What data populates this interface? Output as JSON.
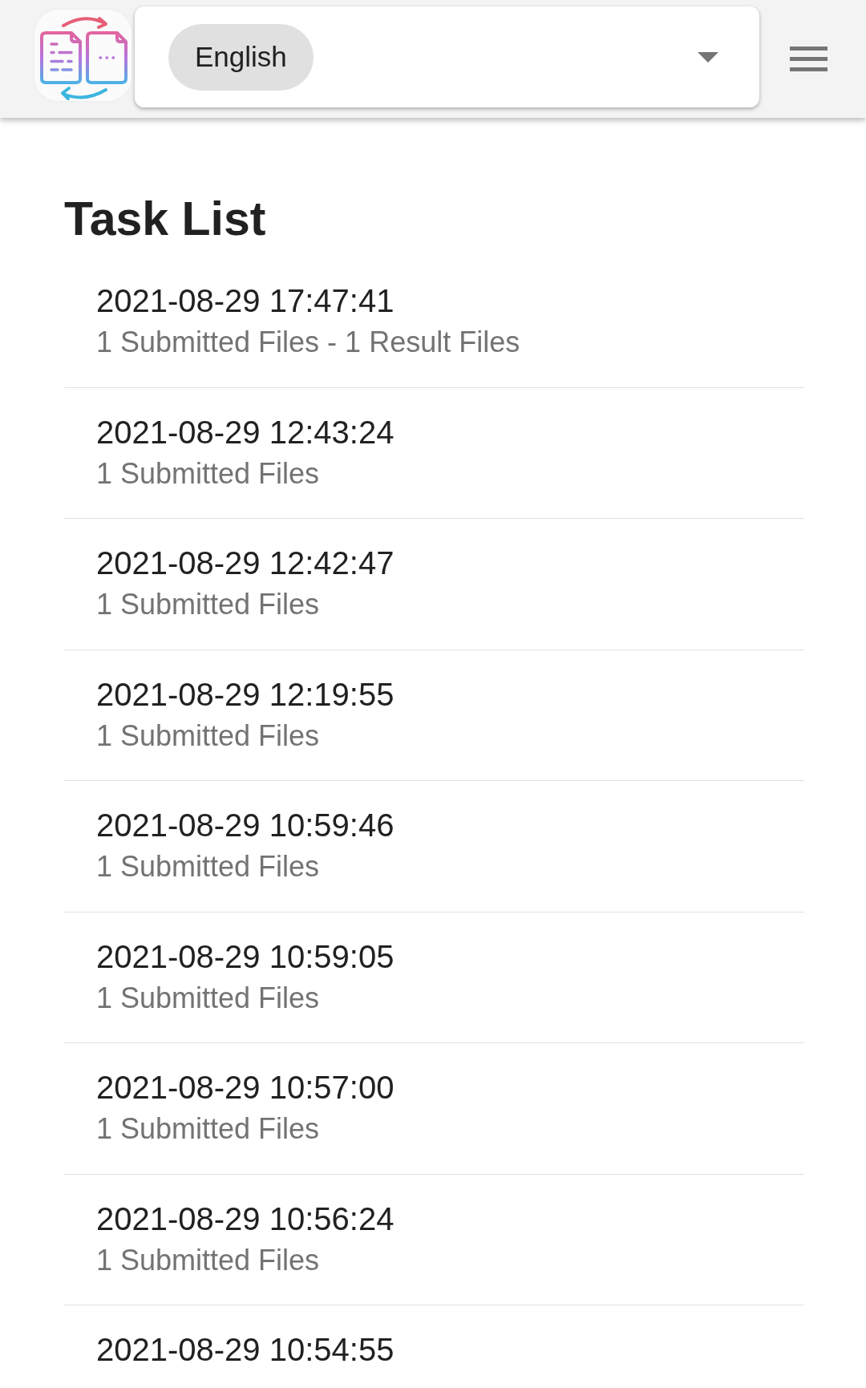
{
  "header": {
    "language_select": {
      "value": "English"
    }
  },
  "page": {
    "title": "Task List"
  },
  "tasks": [
    {
      "timestamp": "2021-08-29 17:47:41",
      "summary": "1 Submitted Files - 1 Result Files"
    },
    {
      "timestamp": "2021-08-29 12:43:24",
      "summary": "1 Submitted Files"
    },
    {
      "timestamp": "2021-08-29 12:42:47",
      "summary": "1 Submitted Files"
    },
    {
      "timestamp": "2021-08-29 12:19:55",
      "summary": "1 Submitted Files"
    },
    {
      "timestamp": "2021-08-29 10:59:46",
      "summary": "1 Submitted Files"
    },
    {
      "timestamp": "2021-08-29 10:59:05",
      "summary": "1 Submitted Files"
    },
    {
      "timestamp": "2021-08-29 10:57:00",
      "summary": "1 Submitted Files"
    },
    {
      "timestamp": "2021-08-29 10:56:24",
      "summary": "1 Submitted Files"
    },
    {
      "timestamp": "2021-08-29 10:54:55"
    }
  ]
}
